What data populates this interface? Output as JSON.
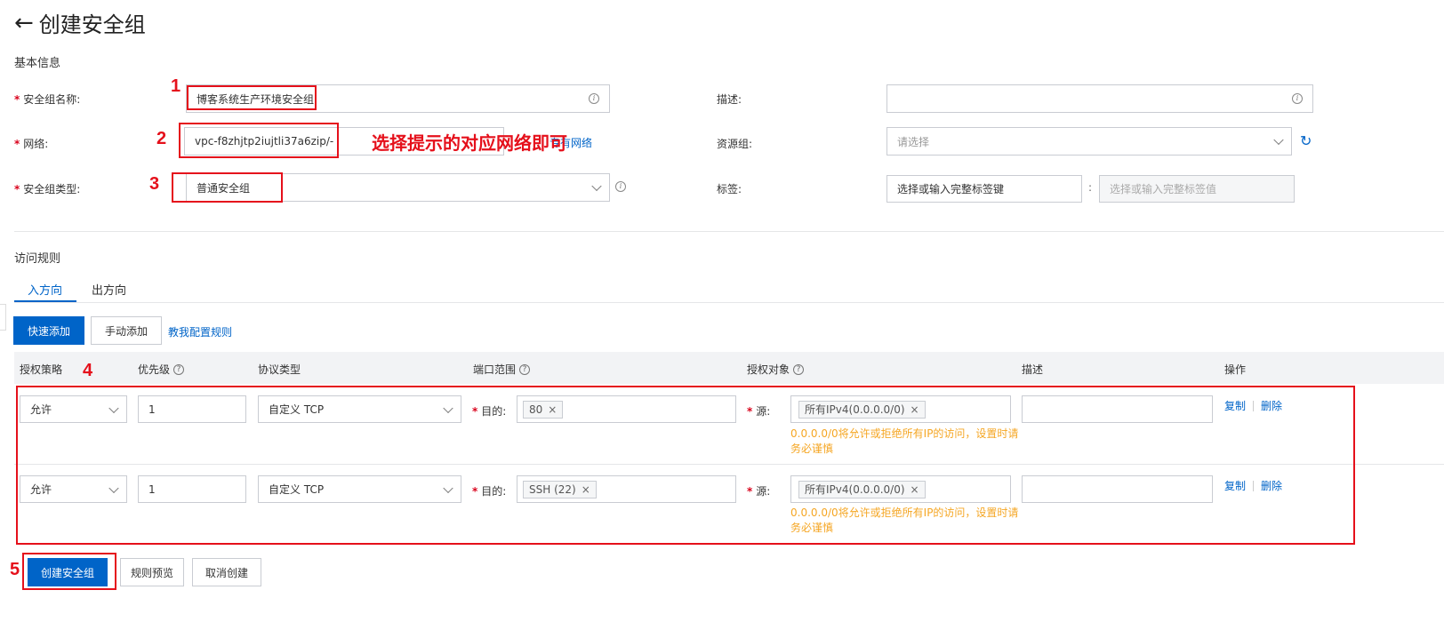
{
  "header": {
    "back_icon": "arrow-left-icon",
    "title": "创建安全组"
  },
  "basic": {
    "section_title": "基本信息",
    "name_label": "安全组名称:",
    "name_value": "博客系统生产环境安全组",
    "network_label": "网络:",
    "network_value": "vpc-f8zhjtp2iujtli37a6zip/-",
    "network_link_partial": "专有网络",
    "type_label": "安全组类型:",
    "type_value": "普通安全组",
    "desc_label": "描述:",
    "resource_label": "资源组:",
    "resource_placeholder": "请选择",
    "tag_label": "标签:",
    "tag_key_placeholder": "选择或输入完整标签键",
    "tag_sep": ":",
    "tag_value_placeholder": "选择或输入完整标签值"
  },
  "annotations": {
    "n1": "1",
    "n2": "2",
    "n3": "3",
    "n4": "4",
    "n5": "5",
    "hint": "选择提示的对应网络即可"
  },
  "rules": {
    "section_title": "访问规则",
    "tabs": [
      {
        "label": "入方向",
        "active": true
      },
      {
        "label": "出方向",
        "active": false
      }
    ],
    "quick_add": "快速添加",
    "manual_add": "手动添加",
    "teach_link": "教我配置规则",
    "columns": [
      "授权策略",
      "优先级",
      "协议类型",
      "端口范围",
      "授权对象",
      "描述",
      "操作"
    ],
    "dest_label": "目的:",
    "src_label": "源:",
    "rows": [
      {
        "policy": "允许",
        "priority": "1",
        "protocol": "自定义 TCP",
        "port_tag": "80",
        "source_tag": "所有IPv4(0.0.0.0/0)",
        "warning_line1": "0.0.0.0/0将允许或拒绝所有IP的访问，设置时请",
        "warning_line2": "务必谨慎",
        "copy": "复制",
        "delete": "删除"
      },
      {
        "policy": "允许",
        "priority": "1",
        "protocol": "自定义 TCP",
        "port_tag": "SSH (22)",
        "source_tag": "所有IPv4(0.0.0.0/0)",
        "warning_line1": "0.0.0.0/0将允许或拒绝所有IP的访问，设置时请",
        "warning_line2": "务必谨慎",
        "copy": "复制",
        "delete": "删除"
      }
    ]
  },
  "footer": {
    "create": "创建安全组",
    "preview": "规则预览",
    "cancel": "取消创建"
  },
  "colors": {
    "primary": "#0064c8",
    "annotation_red": "#e5101b",
    "warning": "#f5a623"
  }
}
